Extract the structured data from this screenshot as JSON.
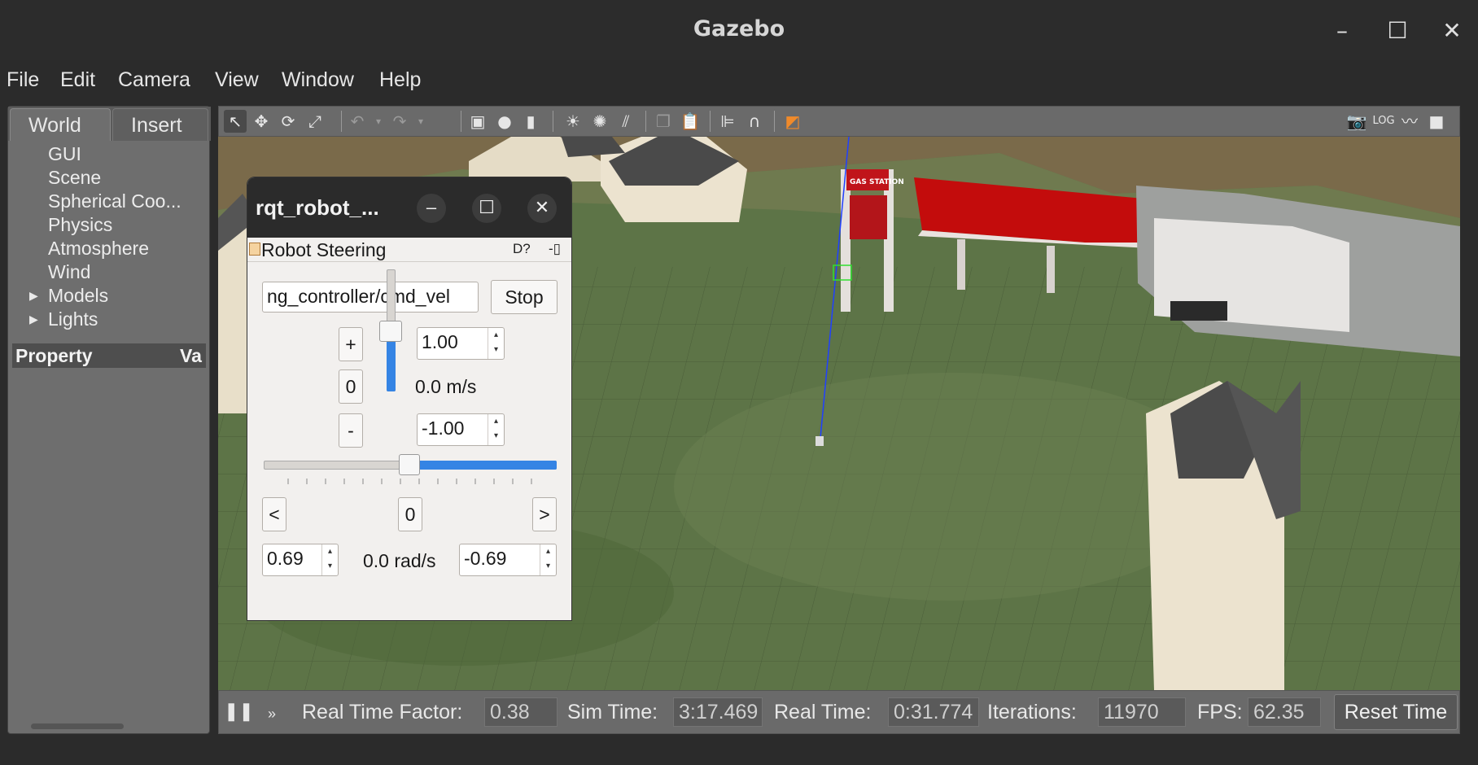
{
  "window": {
    "title": "Gazebo",
    "minimize": "–",
    "maximize": "☐",
    "close": "✕"
  },
  "menu": [
    "File",
    "Edit",
    "Camera",
    "View",
    "Window",
    "Help"
  ],
  "left_panel": {
    "tabs": [
      "World",
      "Insert"
    ],
    "tree": [
      "GUI",
      "Scene",
      "Spherical Coo...",
      "Physics",
      "Atmosphere",
      "Wind",
      "Models",
      "Lights"
    ],
    "property_header": "Property",
    "value_header": "Va"
  },
  "toolbar": {
    "icons": [
      "select-icon",
      "translate-icon",
      "rotate-icon",
      "scale-icon",
      "undo-icon",
      "redo-icon",
      "box-icon",
      "sphere-icon",
      "cylinder-icon",
      "point-light-icon",
      "spot-light-icon",
      "directional-light-icon",
      "copy-icon",
      "paste-icon",
      "align-icon",
      "snap-icon",
      "view-angle-icon",
      "screenshot-icon",
      "log-icon",
      "plot-icon",
      "video-icon"
    ]
  },
  "status": {
    "rtf_label": "Real Time Factor:",
    "rtf": "0.38",
    "sim_label": "Sim Time:",
    "sim": "3:17.469",
    "real_label": "Real Time:",
    "real": "0:31.774",
    "iter_label": "Iterations:",
    "iter": "11970",
    "fps_label": "FPS:",
    "fps": "62.35",
    "reset": "Reset Time",
    "step": "»"
  },
  "rqt": {
    "title": "rqt_robot_...",
    "plugin": "Robot Steering",
    "plugin_controls": "D?",
    "topic": "ng_controller/cmd_vel",
    "stop": "Stop",
    "plus": "+",
    "zero": "0",
    "minus": "-",
    "max_linear": "1.00",
    "min_linear": "-1.00",
    "linear_readout": "0.0 m/s",
    "linear_level": 0.5,
    "angular_level": 0.5,
    "left": "<",
    "right": ">",
    "angular_zero": "0",
    "max_angular": "0.69",
    "min_angular": "-0.69",
    "angular_readout": "0.0 rad/s"
  }
}
